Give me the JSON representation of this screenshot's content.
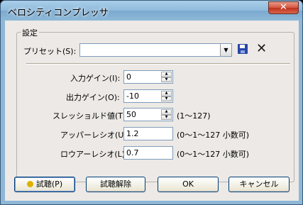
{
  "window": {
    "title": "ベロシティコンプレッサ",
    "close_glyph": "✕"
  },
  "group": {
    "label": "設定"
  },
  "preset": {
    "label": "プリセット(S):",
    "value": "",
    "save_icon": "floppy-disk",
    "delete_glyph": "✕"
  },
  "fields": [
    {
      "label": "入力ゲイン(I):",
      "value": "0",
      "kind": "spin",
      "hint": ""
    },
    {
      "label": "出力ゲイン(O):",
      "value": "-10",
      "kind": "spin",
      "hint": ""
    },
    {
      "label": "スレッショルド値(T):",
      "value": "50",
      "kind": "spin",
      "hint": "(1～127)"
    },
    {
      "label": "アッパーレシオ(U):",
      "value": "1.2",
      "kind": "text",
      "hint": "(0～1～127  小数可)"
    },
    {
      "label": "ロウアーレシオ(L):",
      "value": "0.7",
      "kind": "text",
      "hint": "(0～1～127  小数可)"
    }
  ],
  "buttons": {
    "audition": "試聴(P)",
    "unaudition": "試聴解除",
    "ok": "OK",
    "cancel": "キャンセル"
  }
}
